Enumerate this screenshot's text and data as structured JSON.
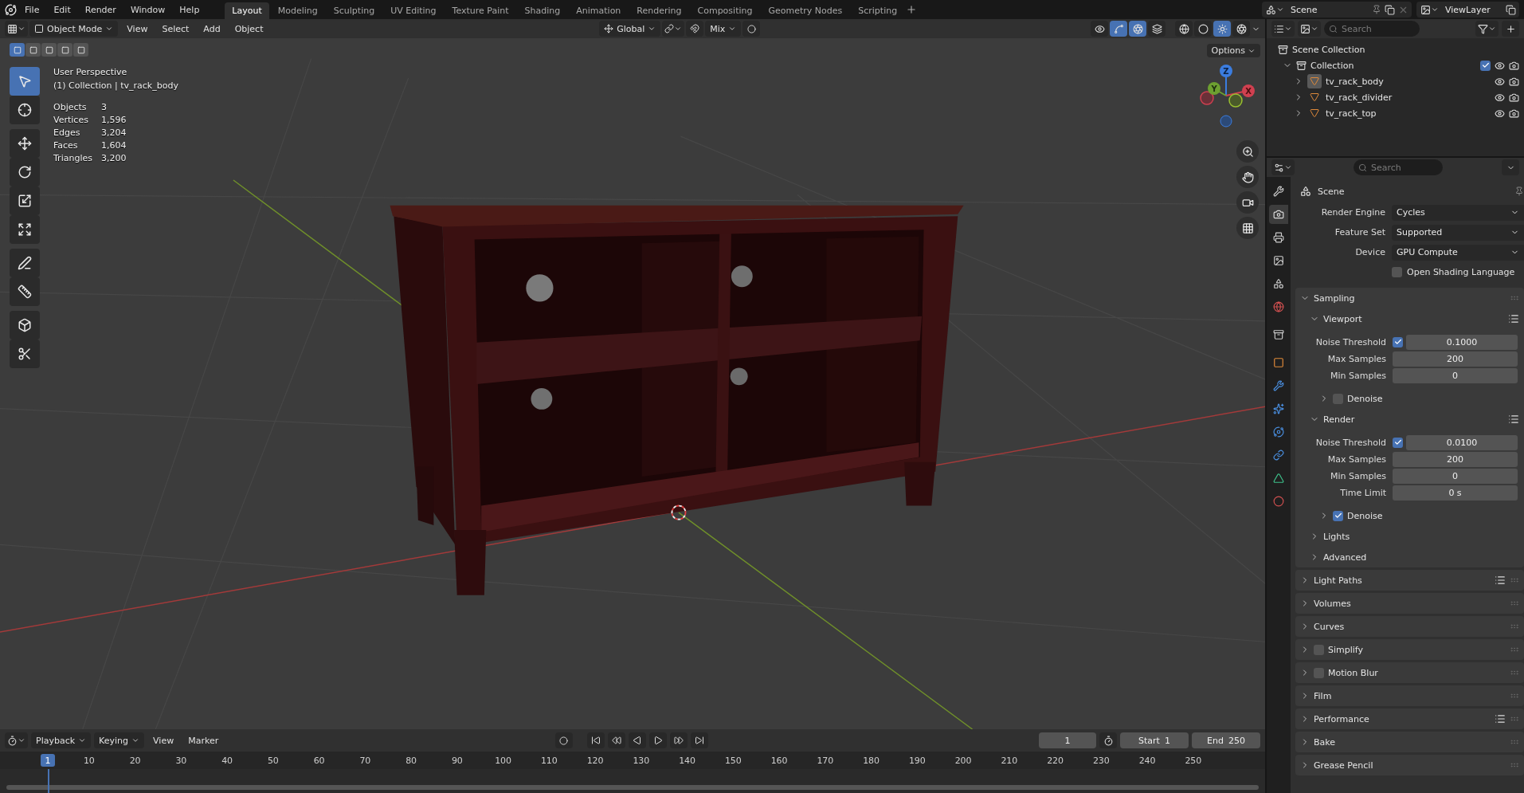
{
  "menu": [
    "File",
    "Edit",
    "Render",
    "Window",
    "Help"
  ],
  "workspaces": [
    {
      "label": "Layout",
      "selected": true
    },
    {
      "label": "Modeling",
      "selected": false
    },
    {
      "label": "Sculpting",
      "selected": false
    },
    {
      "label": "UV Editing",
      "selected": false
    },
    {
      "label": "Texture Paint",
      "selected": false
    },
    {
      "label": "Shading",
      "selected": false
    },
    {
      "label": "Animation",
      "selected": false
    },
    {
      "label": "Rendering",
      "selected": false
    },
    {
      "label": "Compositing",
      "selected": false
    },
    {
      "label": "Geometry Nodes",
      "selected": false
    },
    {
      "label": "Scripting",
      "selected": false
    }
  ],
  "scene": "Scene",
  "view_layer": "ViewLayer",
  "viewport": {
    "mode": "Object Mode",
    "menus": [
      "View",
      "Select",
      "Add",
      "Object"
    ],
    "orientation": "Global",
    "snap_target": "Mix",
    "select_modes": [
      {
        "selected": true
      },
      {
        "selected": false
      },
      {
        "selected": false
      },
      {
        "selected": false
      },
      {
        "selected": false
      }
    ],
    "overlay_toggles": [
      {
        "selected": false
      },
      {
        "selected": true
      },
      {
        "selected": true
      },
      {
        "selected": false
      }
    ],
    "shading_modes": [
      {
        "selected": false
      },
      {
        "selected": false
      },
      {
        "selected": true
      },
      {
        "selected": false
      }
    ],
    "options": "Options",
    "view_name": "User Perspective",
    "context": "(1) Collection | tv_rack_body",
    "stats": [
      {
        "label": "Objects",
        "value": "3"
      },
      {
        "label": "Vertices",
        "value": "1,596"
      },
      {
        "label": "Edges",
        "value": "3,204"
      },
      {
        "label": "Faces",
        "value": "1,604"
      },
      {
        "label": "Triangles",
        "value": "3,200"
      }
    ],
    "tools": [
      {
        "selected": true
      },
      {
        "selected": false
      },
      {
        "selected": false
      },
      {
        "selected": false
      },
      {
        "selected": false
      },
      {
        "selected": false
      },
      {
        "selected": false
      },
      {
        "selected": false
      },
      {
        "selected": false
      },
      {
        "selected": false
      }
    ],
    "gizmo_axes": [
      "Z",
      "Y",
      "X"
    ]
  },
  "outliner": {
    "search_placeholder": "Search",
    "root": "Scene Collection",
    "collection": {
      "name": "Collection",
      "expanded": true,
      "checked": true,
      "children": [
        {
          "name": "tv_rack_body",
          "selected": true
        },
        {
          "name": "tv_rack_divider",
          "selected": false
        },
        {
          "name": "tv_rack_top",
          "selected": false
        }
      ]
    }
  },
  "properties": {
    "search_placeholder": "Search",
    "tabs": [
      {
        "selected": false
      },
      {
        "selected": true
      },
      {
        "selected": false
      },
      {
        "selected": false
      },
      {
        "selected": false
      },
      {
        "selected": false
      },
      {
        "selected": false
      },
      {
        "selected": false
      },
      {
        "selected": false
      },
      {
        "selected": false
      },
      {
        "selected": false
      },
      {
        "selected": false
      },
      {
        "selected": false
      },
      {
        "selected": false
      }
    ],
    "context": "Scene",
    "fields": [
      {
        "label": "Render Engine",
        "value": "Cycles"
      },
      {
        "label": "Feature Set",
        "value": "Supported"
      },
      {
        "label": "Device",
        "value": "GPU Compute"
      }
    ],
    "osl": {
      "label": "Open Shading Language",
      "checked": false
    },
    "panels": [
      {
        "title": "Sampling",
        "expanded": true,
        "subpanels": [
          {
            "title": "Viewport",
            "expanded": true,
            "presets": true,
            "rows": [
              {
                "kind": "check_number",
                "label": "Noise Threshold",
                "checked": true,
                "value": "0.1000"
              },
              {
                "kind": "number",
                "label": "Max Samples",
                "value": "200"
              },
              {
                "kind": "number",
                "label": "Min Samples",
                "value": "0"
              }
            ],
            "subpanels": [
              {
                "title": "Denoise",
                "expanded": false,
                "checked": false
              }
            ]
          },
          {
            "title": "Render",
            "expanded": true,
            "presets": true,
            "rows": [
              {
                "kind": "check_number",
                "label": "Noise Threshold",
                "checked": true,
                "value": "0.0100"
              },
              {
                "kind": "number",
                "label": "Max Samples",
                "value": "200"
              },
              {
                "kind": "number",
                "label": "Min Samples",
                "value": "0"
              },
              {
                "kind": "number",
                "label": "Time Limit",
                "value": "0 s"
              }
            ],
            "subpanels": [
              {
                "title": "Denoise",
                "expanded": false,
                "checked": true
              }
            ]
          },
          {
            "title": "Lights",
            "expanded": false
          },
          {
            "title": "Advanced",
            "expanded": false
          }
        ]
      },
      {
        "title": "Light Paths",
        "expanded": false,
        "presets": true
      },
      {
        "title": "Volumes",
        "expanded": false
      },
      {
        "title": "Curves",
        "expanded": false
      },
      {
        "title": "Simplify",
        "expanded": false,
        "checked": false
      },
      {
        "title": "Motion Blur",
        "expanded": false,
        "checked": false
      },
      {
        "title": "Film",
        "expanded": false
      },
      {
        "title": "Performance",
        "expanded": false,
        "presets": true
      },
      {
        "title": "Bake",
        "expanded": false
      },
      {
        "title": "Grease Pencil",
        "expanded": false
      }
    ]
  },
  "timeline": {
    "menus": [
      {
        "label": "Playback",
        "kind": "dropdown"
      },
      {
        "label": "Keying",
        "kind": "dropdown"
      },
      {
        "label": "View",
        "kind": "menu"
      },
      {
        "label": "Marker",
        "kind": "menu"
      }
    ],
    "auto_key": false,
    "frame_field": "1",
    "start_label": "Start",
    "start": "1",
    "end_label": "End",
    "end": "250",
    "current_frame": "1",
    "ticks": [
      "10",
      "20",
      "30",
      "40",
      "50",
      "60",
      "70",
      "80",
      "90",
      "100",
      "110",
      "120",
      "130",
      "140",
      "150",
      "160",
      "170",
      "180",
      "190",
      "200",
      "210",
      "220",
      "230",
      "240",
      "250"
    ]
  }
}
